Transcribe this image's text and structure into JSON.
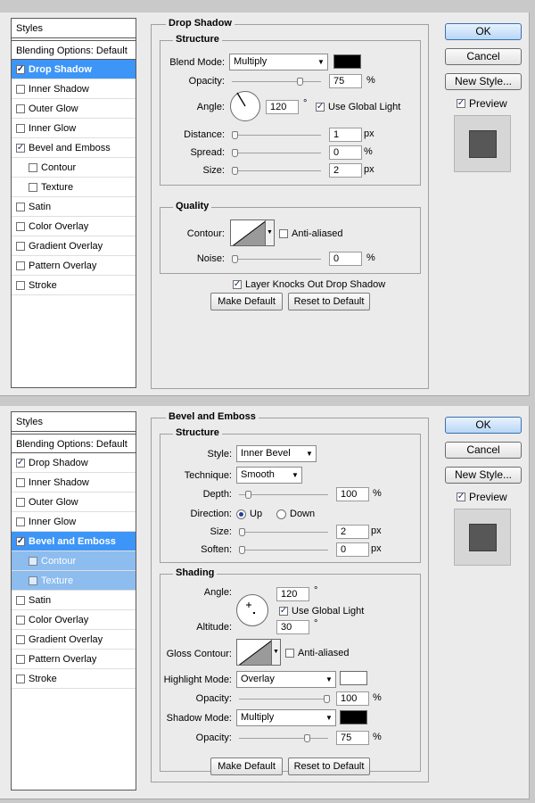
{
  "styles_list": {
    "header": "Styles",
    "blending": "Blending Options: Default",
    "items": [
      "Drop Shadow",
      "Inner Shadow",
      "Outer Glow",
      "Inner Glow",
      "Bevel and Emboss",
      "Contour",
      "Texture",
      "Satin",
      "Color Overlay",
      "Gradient Overlay",
      "Pattern Overlay",
      "Stroke"
    ]
  },
  "buttons": {
    "ok": "OK",
    "cancel": "Cancel",
    "new_style": "New Style...",
    "preview": "Preview",
    "make_default": "Make Default",
    "reset_default": "Reset to Default"
  },
  "drop_shadow": {
    "title": "Drop Shadow",
    "structure": "Structure",
    "blend_mode_label": "Blend Mode:",
    "blend_mode": "Multiply",
    "blend_color": "#000000",
    "opacity_label": "Opacity:",
    "opacity": "75",
    "opacity_value": 75,
    "angle_label": "Angle:",
    "angle": "120",
    "angle_unit": "°",
    "use_global_light": "Use Global Light",
    "distance_label": "Distance:",
    "distance": "1",
    "distance_value": 1,
    "spread_label": "Spread:",
    "spread": "0",
    "spread_value": 0,
    "size_label": "Size:",
    "size": "2",
    "size_value": 2,
    "quality": "Quality",
    "contour_label": "Contour:",
    "anti_aliased": "Anti-aliased",
    "noise_label": "Noise:",
    "noise": "0",
    "noise_value": 0,
    "knock_out": "Layer Knocks Out Drop Shadow",
    "px": "px",
    "pct": "%"
  },
  "bevel": {
    "title": "Bevel and Emboss",
    "structure": "Structure",
    "style_label": "Style:",
    "style": "Inner Bevel",
    "technique_label": "Technique:",
    "technique": "Smooth",
    "depth_label": "Depth:",
    "depth": "100",
    "depth_value": 100,
    "direction_label": "Direction:",
    "up": "Up",
    "down": "Down",
    "size_label": "Size:",
    "size": "2",
    "size_value": 2,
    "soften_label": "Soften:",
    "soften": "0",
    "soften_value": 0,
    "shading": "Shading",
    "angle_label": "Angle:",
    "angle": "120",
    "angle_unit": "°",
    "use_global_light": "Use Global Light",
    "altitude_label": "Altitude:",
    "altitude": "30",
    "altitude_unit": "°",
    "gloss_label": "Gloss Contour:",
    "anti_aliased": "Anti-aliased",
    "highlight_label": "Highlight Mode:",
    "highlight_mode": "Overlay",
    "highlight_color": "#ffffff",
    "h_opacity_label": "Opacity:",
    "h_opacity": "100",
    "h_opacity_value": 100,
    "shadow_label": "Shadow Mode:",
    "shadow_mode": "Multiply",
    "shadow_color": "#000000",
    "s_opacity_label": "Opacity:",
    "s_opacity": "75",
    "s_opacity_value": 75,
    "px": "px",
    "pct": "%"
  },
  "colors": {
    "selected": "#3d95f7",
    "sub_selected": "#8dbcef",
    "preview_fill": "#575757"
  }
}
